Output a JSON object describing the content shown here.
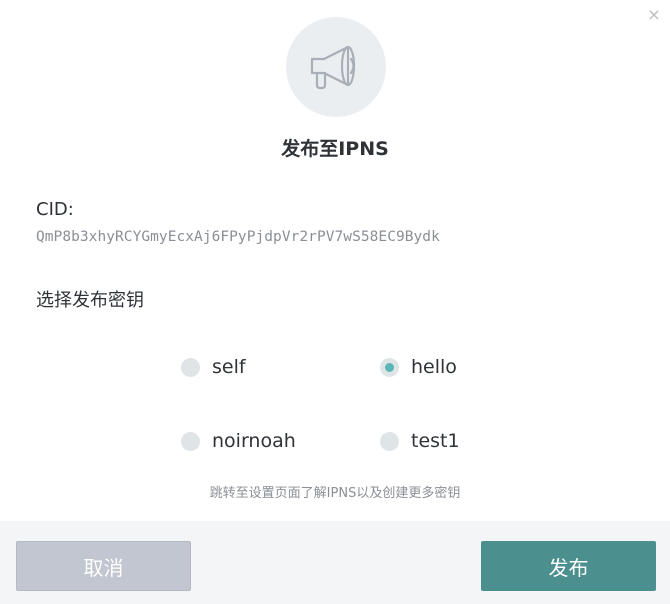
{
  "dialog": {
    "close_symbol": "×",
    "header_icon": "megaphone-icon",
    "title": "发布至IPNS",
    "cid_label": "CID:",
    "cid_value": "QmP8b3xhyRCYGmyEcxAj6FPyPjdpVr2rPV7wS58EC9Bydk",
    "choose_key_label": "选择发布密钥",
    "keys": [
      {
        "label": "self",
        "checked": false
      },
      {
        "label": "hello",
        "checked": true
      },
      {
        "label": "noirnoah",
        "checked": false
      },
      {
        "label": "test1",
        "checked": false
      }
    ],
    "help_link": "跳转至设置页面了解IPNS以及创建更多密钥",
    "cancel_label": "取消",
    "publish_label": "发布"
  },
  "colors": {
    "accent": "#4c8f8f",
    "radio_checked": "#5bb6b8",
    "cancel_bg": "#c1c6d0",
    "footer_bg": "#f3f5f6"
  }
}
